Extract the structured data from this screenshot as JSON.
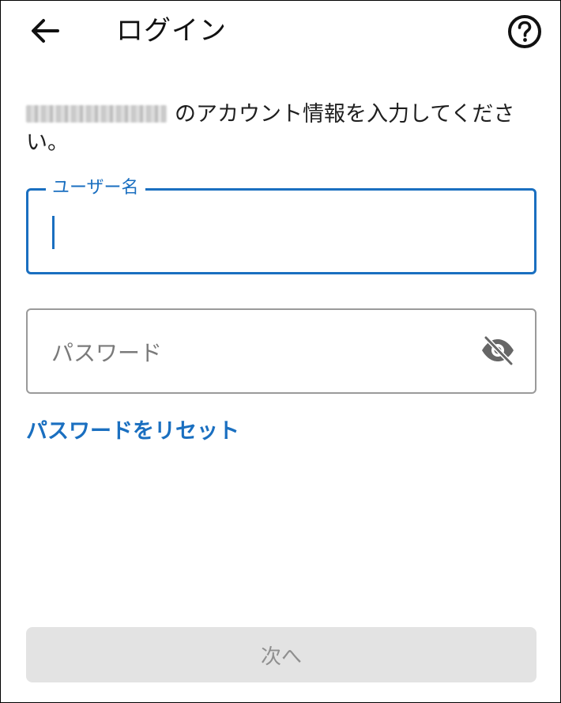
{
  "header": {
    "title": "ログイン",
    "back_icon": "arrow-left-icon",
    "help_icon": "question-circle-icon"
  },
  "instruction": {
    "suffix": "のアカウント情報を入力してください。"
  },
  "username": {
    "label": "ユーザー名",
    "value": "",
    "focused": true
  },
  "password": {
    "placeholder": "パスワード",
    "value": "",
    "visibility_icon": "eye-off-icon"
  },
  "links": {
    "reset_password": "パスワードをリセット"
  },
  "actions": {
    "next_label": "次へ",
    "next_enabled": false
  },
  "colors": {
    "accent": "#1a6fc0",
    "border_default": "#9a9a9a",
    "button_disabled_bg": "#e3e3e3",
    "button_disabled_text": "#8f8f8f"
  }
}
